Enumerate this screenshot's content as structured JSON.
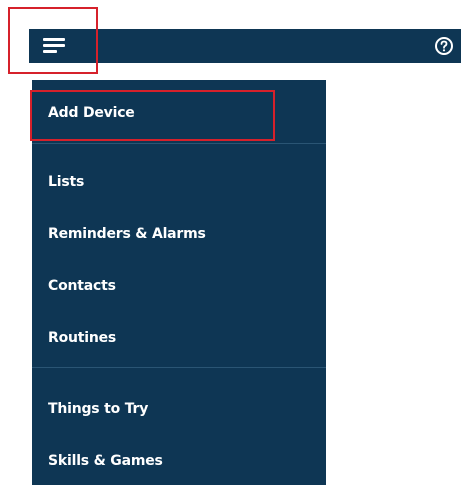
{
  "header": {
    "menu_icon": "hamburger-menu-icon",
    "help_icon": "help-question-icon"
  },
  "menu": {
    "sections": [
      {
        "items": [
          {
            "label": "Add Device"
          }
        ]
      },
      {
        "items": [
          {
            "label": "Lists"
          },
          {
            "label": "Reminders & Alarms"
          },
          {
            "label": "Contacts"
          },
          {
            "label": "Routines"
          }
        ]
      },
      {
        "items": [
          {
            "label": "Things to Try"
          },
          {
            "label": "Skills & Games"
          }
        ]
      }
    ]
  },
  "colors": {
    "panel_bg": "#0e3654",
    "text": "#ffffff",
    "highlight": "#d6212b"
  }
}
